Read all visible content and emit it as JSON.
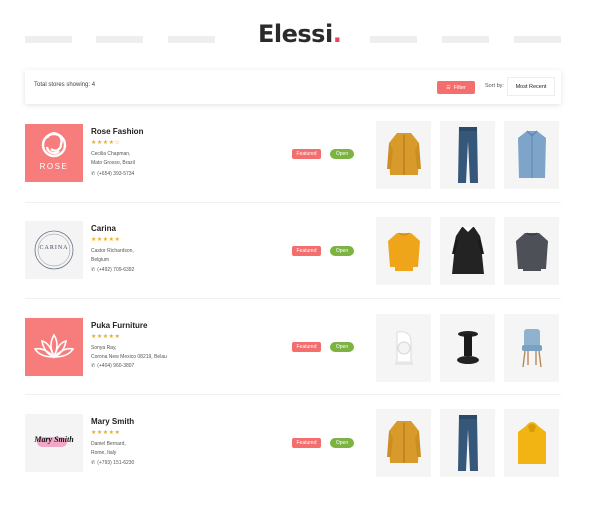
{
  "header": {
    "logo_text": "Elessi",
    "logo_dot": "."
  },
  "filterbar": {
    "total_label": "Total stores showing: 4",
    "filter_label": "Filter",
    "sort_label": "Sort by:",
    "sort_value": "Most Recent"
  },
  "colors": {
    "brand_coral": "#f46e6e",
    "open_green": "#7cb342",
    "star_yellow": "#f4a91d",
    "logo_dot": "#e8445a"
  },
  "stores": [
    {
      "name": "Rose Fashion",
      "stars": "★★★★☆",
      "address_line1": "Cecilia Chapman,",
      "address_line2": "Mato Grosso, Brazil",
      "phone": "(+654) 393-5734",
      "logo_icon": "rose-logo-icon",
      "logo_text": "ROSE",
      "featured_label": "Featured",
      "open_label": "Open",
      "products": [
        "mustard-jacket-icon",
        "blue-jeans-icon",
        "denim-shirt-icon"
      ]
    },
    {
      "name": "Carina",
      "stars": "★★★★★",
      "address_line1": "Castor Richardson,",
      "address_line2": "Belgium",
      "phone": "(+492) 709-6392",
      "logo_icon": "carina-logo-icon",
      "logo_text": "CARINA",
      "featured_label": "Featured",
      "open_label": "Open",
      "products": [
        "yellow-sweater-icon",
        "black-dress-icon",
        "grey-sweater-icon"
      ]
    },
    {
      "name": "Puka Furniture",
      "stars": "★★★★★",
      "address_line1": "Sonya Ray,",
      "address_line2": "Corona New Mexico 08219, Belau",
      "phone": "(+404) 960-3807",
      "logo_icon": "lotus-logo-icon",
      "featured_label": "Featured",
      "open_label": "Open",
      "products": [
        "white-lamp-icon",
        "black-stool-icon",
        "blue-chair-icon"
      ]
    },
    {
      "name": "Mary Smith",
      "stars": "★★★★★",
      "address_line1": "Daniel Bernard,",
      "address_line2": "Rome, Italy",
      "phone": "(+793) 151-6230",
      "logo_icon": "mary-smith-logo-icon",
      "logo_text": "Mary Smith",
      "featured_label": "Featured",
      "open_label": "Open",
      "products": [
        "mustard-jacket-icon",
        "blue-jeans-icon",
        "yellow-hoodie-icon"
      ]
    }
  ]
}
